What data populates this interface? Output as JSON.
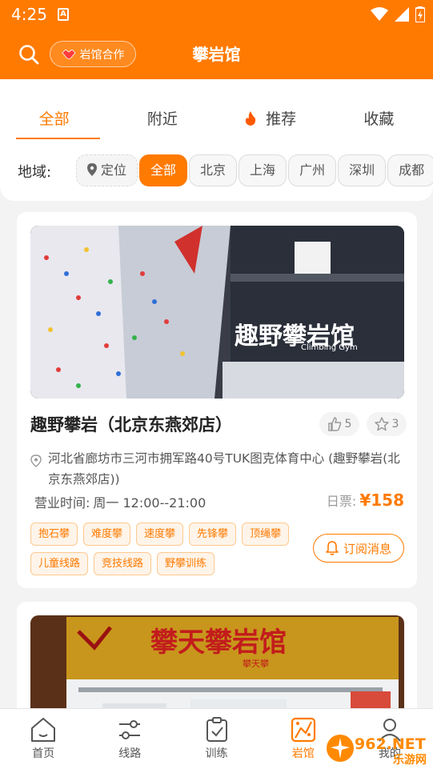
{
  "status_bar": {
    "time": "4:25",
    "notification_letter": "A"
  },
  "app_bar": {
    "title": "攀岩馆",
    "coop_button_label": "岩馆合作",
    "search_icon": "search-icon"
  },
  "tabs": [
    {
      "label": "全部",
      "active": true
    },
    {
      "label": "附近",
      "active": false
    },
    {
      "label": "推荐",
      "active": false,
      "icon": "fire-icon"
    },
    {
      "label": "收藏",
      "active": false
    }
  ],
  "region": {
    "label": "地域:",
    "chips": [
      {
        "label": "定位",
        "type": "locate"
      },
      {
        "label": "全部",
        "active": true
      },
      {
        "label": "北京"
      },
      {
        "label": "上海"
      },
      {
        "label": "广州"
      },
      {
        "label": "深圳"
      },
      {
        "label": "成都"
      }
    ]
  },
  "gyms": [
    {
      "photo_sign": "趣野攀岩馆",
      "photo_sign_sub": "Climbing Gym",
      "name": "趣野攀岩（北京东燕郊店）",
      "likes": "5",
      "favorites": "3",
      "address": "河北省廊坊市三河市拥军路40号TUK图克体育中心 (趣野攀岩(北京东燕郊店))",
      "hours_label": "营业时间:",
      "hours": "周一 12:00--21:00",
      "ticket_label": "日票:",
      "price": "¥158",
      "tags": [
        "抱石攀",
        "难度攀",
        "速度攀",
        "先锋攀",
        "顶绳攀",
        "儿童线路",
        "竞技线路",
        "野攀训练"
      ],
      "subscribe_label": "订阅消息"
    },
    {
      "photo_sign": "攀天攀岩馆",
      "photo_sign_sub": "攀天攀"
    }
  ],
  "bottom_nav": [
    {
      "label": "首页",
      "icon": "home-icon"
    },
    {
      "label": "线路",
      "icon": "route-icon"
    },
    {
      "label": "训练",
      "icon": "training-icon"
    },
    {
      "label": "岩馆",
      "icon": "gym-icon",
      "active": true
    },
    {
      "label": "我的",
      "icon": "profile-icon"
    }
  ],
  "watermark": {
    "text": "962.NET",
    "sub": "乐游网"
  },
  "colors": {
    "accent": "#ff7a00",
    "tag_bg": "#fff4e9"
  }
}
